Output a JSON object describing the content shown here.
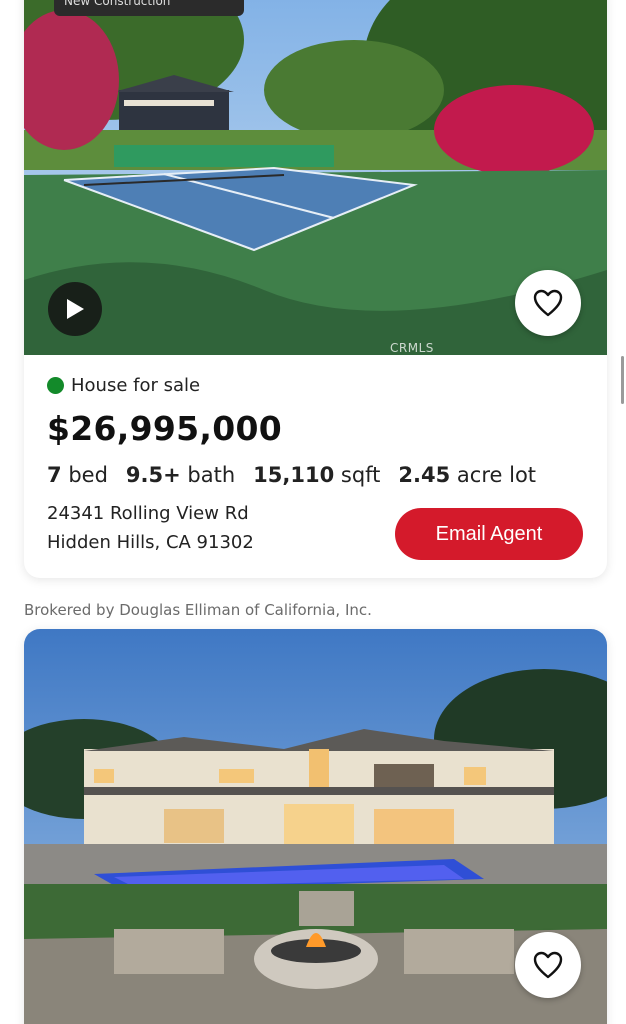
{
  "listing1": {
    "tag_text": "New Construction",
    "status": "House for sale",
    "status_color": "#138a2a",
    "price": "$26,995,000",
    "beds_value": "7",
    "beds_unit": "bed",
    "baths_value": "9.5+",
    "baths_unit": "bath",
    "sqft_value": "15,110",
    "sqft_unit": "sqft",
    "lot_value": "2.45",
    "lot_unit": "acre lot",
    "address_line1": "24341 Rolling View Rd",
    "address_line2": "Hidden Hills, CA 91302",
    "email_button": "Email Agent",
    "watermark": "CRMLS",
    "play_icon": "play-icon",
    "favorite_icon": "heart-outline-icon"
  },
  "broker_text": "Brokered by Douglas Elliman of California, Inc.",
  "listing2": {
    "favorite_icon": "heart-outline-icon"
  },
  "colors": {
    "accent": "#d41a2b",
    "status_green": "#138a2a"
  }
}
